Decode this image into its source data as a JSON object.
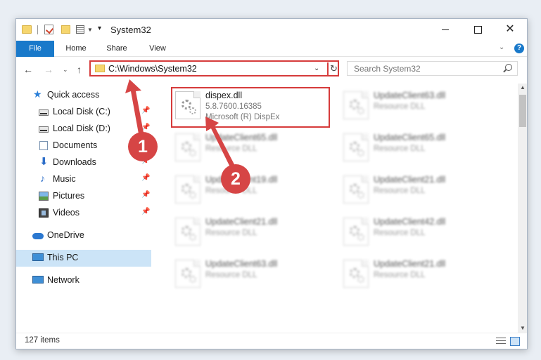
{
  "window": {
    "title": "System32",
    "minimize": "",
    "maximize": "",
    "close": "✕"
  },
  "ribbon": {
    "tabs": [
      "File",
      "Home",
      "Share",
      "View"
    ],
    "help": "?",
    "collapse": "⌄"
  },
  "nav": {
    "back": "←",
    "forward": "→",
    "recent": "⌄",
    "up": "↑",
    "address": "C:\\Windows\\System32",
    "address_dropdown": "⌄",
    "refresh": "↻",
    "search_placeholder": "Search System32"
  },
  "sidebar": {
    "items": [
      {
        "label": "Quick access",
        "icon": "star-icon",
        "pinned": false
      },
      {
        "label": "Local Disk (C:)",
        "icon": "drive-icon",
        "pinned": true
      },
      {
        "label": "Local Disk (D:)",
        "icon": "drive-icon",
        "pinned": true
      },
      {
        "label": "Documents",
        "icon": "documents-icon",
        "pinned": true
      },
      {
        "label": "Downloads",
        "icon": "download-icon",
        "pinned": true
      },
      {
        "label": "Music",
        "icon": "music-icon",
        "pinned": true
      },
      {
        "label": "Pictures",
        "icon": "pictures-icon",
        "pinned": true
      },
      {
        "label": "Videos",
        "icon": "videos-icon",
        "pinned": true
      },
      {
        "label": "OneDrive",
        "icon": "onedrive-icon",
        "pinned": false
      },
      {
        "label": "This PC",
        "icon": "pc-icon",
        "pinned": false,
        "selected": true
      },
      {
        "label": "Network",
        "icon": "network-icon",
        "pinned": false
      }
    ],
    "pin_glyph": "📌"
  },
  "files": {
    "selected": {
      "name": "dispex.dll",
      "version": "5.8.7600.16385",
      "description": "Microsoft (R) DispEx"
    },
    "others": [
      {
        "name": "UpdateClient63.dll",
        "description": "Resource DLL"
      },
      {
        "name": "UpdateClient65.dll",
        "description": "Resource DLL"
      },
      {
        "name": "UpdateClient65.dll",
        "description": "Resource DLL"
      },
      {
        "name": "UpdateClient19.dll",
        "description": "Resource DLL"
      },
      {
        "name": "UpdateClient21.dll",
        "description": "Resource DLL"
      },
      {
        "name": "UpdateClient21.dll",
        "description": "Resource DLL"
      },
      {
        "name": "UpdateClient42.dll",
        "description": "Resource DLL"
      },
      {
        "name": "UpdateClient63.dll",
        "description": "Resource DLL"
      },
      {
        "name": "UpdateClient21.dll",
        "description": "Resource DLL"
      }
    ]
  },
  "status": {
    "item_count": "127 items"
  },
  "annotations": {
    "badge1": "1",
    "badge2": "2",
    "color": "#d64545"
  },
  "colors": {
    "accent": "#1979ca",
    "highlight": "#d63b3b",
    "selection": "#cce4f7"
  }
}
